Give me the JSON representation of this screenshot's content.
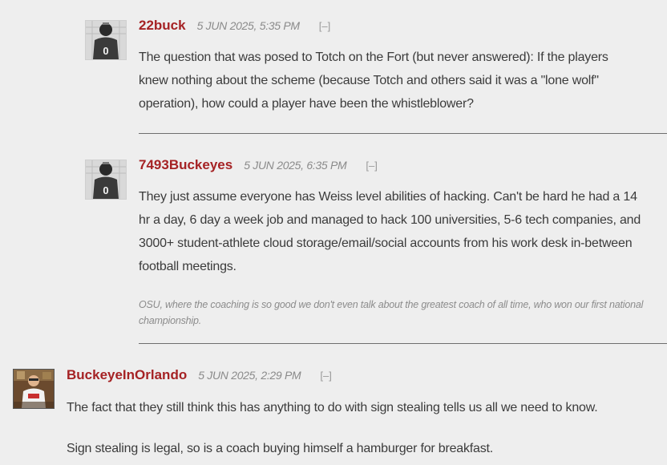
{
  "comments": [
    {
      "author": "22buck",
      "timestamp": "5 JUN 2025, 5:35 PM",
      "collapse": "[–]",
      "avatar": "ohio-state-player-avatar-icon",
      "paragraphs": [
        "The question that was posed to Totch on the Fort (but never answered): If the players knew nothing about the scheme (because Totch and others said it was a \"lone wolf\" operation), how could a player have been the whistleblower?"
      ]
    },
    {
      "author": "7493Buckeyes",
      "timestamp": "5 JUN 2025, 6:35 PM",
      "collapse": "[–]",
      "avatar": "ohio-state-player-avatar-icon",
      "paragraphs": [
        "They just assume everyone has Weiss level abilities of hacking. Can't be hard he had a 14 hr a day, 6 day a week job and managed to hack 100 universities, 5-6 tech companies, and 3000+ student-athlete cloud storage/email/social accounts from his work desk in-between football meetings."
      ],
      "signature": "OSU, where the coaching is so good we don't even talk about the greatest coach of all time, who won our first national championship."
    },
    {
      "author": "BuckeyeInOrlando",
      "timestamp": "5 JUN 2025, 2:29 PM",
      "collapse": "[–]",
      "avatar": "user-photo-avatar-icon",
      "paragraphs": [
        "The fact that they still think this has anything to do with sign stealing tells us all we need to know.",
        "Sign stealing is legal, so is a coach buying himself a hamburger for breakfast."
      ]
    }
  ],
  "colors": {
    "author": "#a52224",
    "background": "#eeeeee",
    "text": "#3b3b3b",
    "meta": "#8a8a8a"
  }
}
